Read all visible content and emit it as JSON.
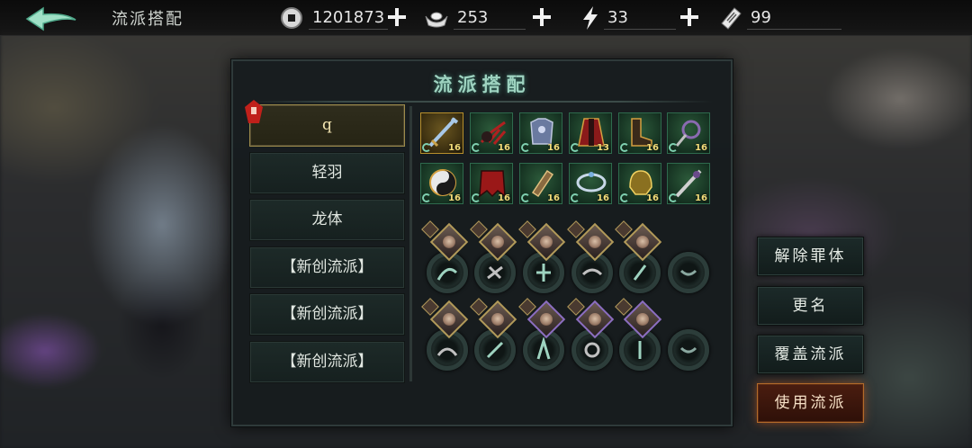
{
  "header": {
    "title": "流派搭配",
    "currencies": [
      {
        "name": "coin",
        "icon": "copper-coin-icon",
        "value": "1201873"
      },
      {
        "name": "ingot",
        "icon": "silver-ingot-icon",
        "value": "253"
      },
      {
        "name": "stamina",
        "icon": "lightning-icon",
        "value": "33"
      },
      {
        "name": "ticket",
        "icon": "ticket-icon",
        "value": "99"
      }
    ]
  },
  "panel": {
    "title": "流派搭配",
    "schools": [
      {
        "label": "q",
        "active": true
      },
      {
        "label": "轻羽",
        "active": false
      },
      {
        "label": "龙体",
        "active": false
      },
      {
        "label": "【新创流派】",
        "active": false
      },
      {
        "label": "【新创流派】",
        "active": false
      },
      {
        "label": "【新创流派】",
        "active": false
      }
    ],
    "equipment": [
      {
        "icon": "sword-icon",
        "level": "16",
        "rarity": "gold"
      },
      {
        "icon": "claw-gauntlet-icon",
        "level": "16",
        "rarity": "green"
      },
      {
        "icon": "armor-icon",
        "level": "16",
        "rarity": "green"
      },
      {
        "icon": "robe-icon",
        "level": "13",
        "rarity": "green"
      },
      {
        "icon": "boots-icon",
        "level": "16",
        "rarity": "green"
      },
      {
        "icon": "whip-icon",
        "level": "16",
        "rarity": "green"
      },
      {
        "icon": "yin-yang-icon",
        "level": "16",
        "rarity": "green"
      },
      {
        "icon": "red-cape-icon",
        "level": "16",
        "rarity": "green"
      },
      {
        "icon": "bracer-icon",
        "level": "16",
        "rarity": "green"
      },
      {
        "icon": "bracelet-icon",
        "level": "16",
        "rarity": "green"
      },
      {
        "icon": "helmet-icon",
        "level": "16",
        "rarity": "green"
      },
      {
        "icon": "blade-icon",
        "level": "16",
        "rarity": "green"
      }
    ]
  },
  "actions": {
    "remove_sin": "解除罪体",
    "rename": "更名",
    "overwrite": "覆盖流派",
    "use": "使用流派"
  }
}
